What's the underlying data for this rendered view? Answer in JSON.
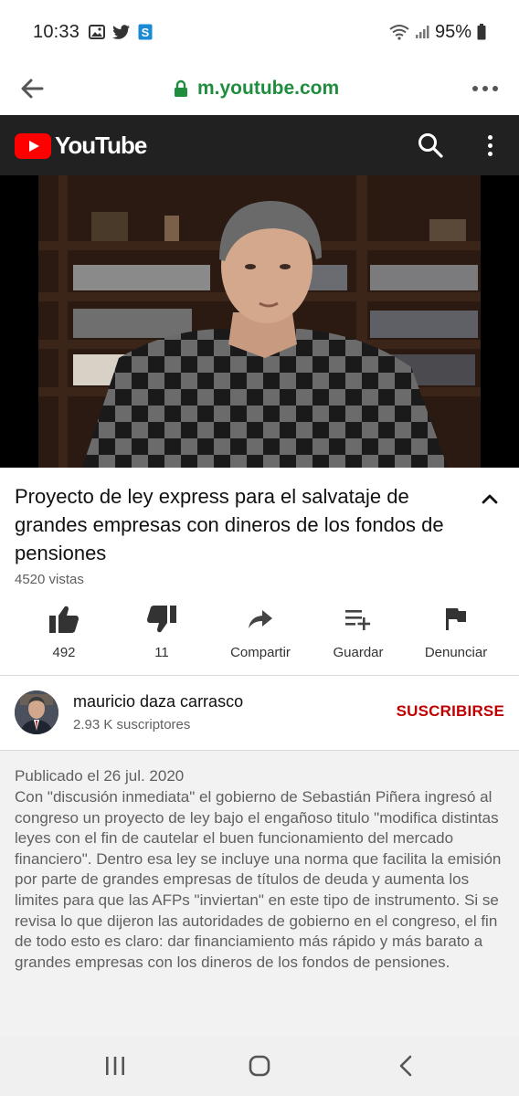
{
  "status_bar": {
    "time": "10:33",
    "battery": "95%",
    "left_icons": [
      "gallery-icon",
      "twitter-icon",
      "app-s-icon"
    ],
    "right_icons": [
      "wifi-icon",
      "signal-icon",
      "battery-icon"
    ]
  },
  "browser": {
    "url": "m.youtube.com",
    "back_icon": "back-arrow-icon",
    "lock_icon": "lock-icon",
    "more_icon": "more-horizontal-icon",
    "url_color": "#1e8e3e"
  },
  "yt_header": {
    "logo_text": "YouTube",
    "search_icon": "search-icon",
    "menu_icon": "more-vertical-icon",
    "bg_color": "#212121",
    "brand_color": "#ff0000"
  },
  "video": {
    "title": "Proyecto de ley express para el salvataje de grandes empresas con dineros de los fondos de pensiones",
    "views": "4520 vistas",
    "collapse_icon": "chevron-up-icon"
  },
  "actions": [
    {
      "icon": "thumbs-up-icon",
      "label": "492"
    },
    {
      "icon": "thumbs-down-icon",
      "label": "11"
    },
    {
      "icon": "share-icon",
      "label": "Compartir"
    },
    {
      "icon": "playlist-add-icon",
      "label": "Guardar"
    },
    {
      "icon": "flag-icon",
      "label": "Denunciar"
    }
  ],
  "channel": {
    "name": "mauricio daza carrasco",
    "subscribers": "2.93 K suscriptores",
    "subscribe_label": "SUSCRIBIRSE",
    "subscribe_color": "#c00000"
  },
  "description": {
    "published": "Publicado el 26 jul. 2020",
    "text": "Con \"discusión inmediata\" el gobierno de Sebastián Piñera ingresó al congreso un proyecto de ley bajo el engañoso titulo \"modifica distintas leyes con el fin de cautelar el buen funcionamiento del mercado financiero\". Dentro esa ley se incluye una norma que facilita la emisión por parte de grandes empresas de títulos de deuda y aumenta los limites para que las AFPs \"inviertan\" en este tipo de instrumento. Si se revisa lo que dijeron las autoridades de gobierno en el congreso, el fin de todo esto es claro: dar financiamiento más rápido y más barato a grandes empresas con los dineros de los fondos de pensiones."
  },
  "nav_bar": {
    "icons": [
      "recent-apps-icon",
      "home-icon",
      "nav-back-icon"
    ]
  }
}
